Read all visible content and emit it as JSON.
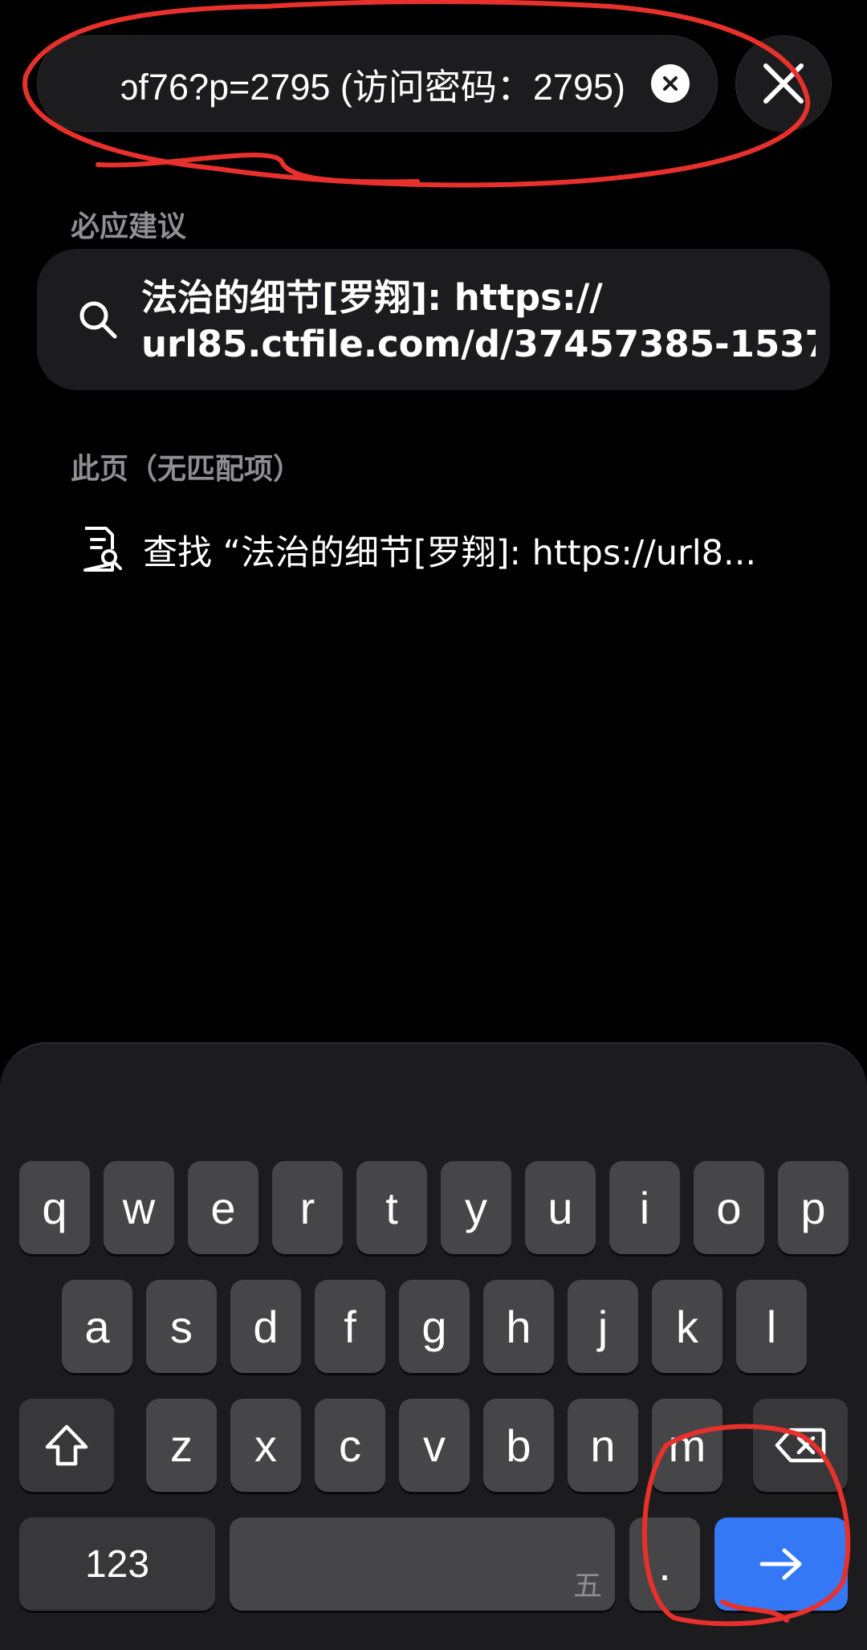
{
  "search": {
    "query_visible": "ɔf76?p=2795 (访问密码：2795)"
  },
  "suggestions": {
    "section_label": "必应建议",
    "item": {
      "bold_part": "法治的细节[罗翔]:",
      "rest_line1": " https://",
      "line2": "url85.ctfile.com/d/37457385-1537..."
    }
  },
  "this_page": {
    "section_label": "此页（无匹配项）",
    "find_text": "查找 “法治的细节[罗翔]: https://url8..."
  },
  "keyboard": {
    "row1": [
      "q",
      "w",
      "e",
      "r",
      "t",
      "y",
      "u",
      "i",
      "o",
      "p"
    ],
    "row2": [
      "a",
      "s",
      "d",
      "f",
      "g",
      "h",
      "j",
      "k",
      "l"
    ],
    "row3": [
      "z",
      "x",
      "c",
      "v",
      "b",
      "n",
      "m"
    ],
    "numbers_key": "123",
    "space_hint": "五",
    "period_key": ".",
    "icons": {
      "shift": "shift-icon",
      "delete": "delete-icon",
      "go": "arrow-right-icon"
    }
  },
  "colors": {
    "accent": "#3478f6",
    "annotation": "#e8302c",
    "background": "#000000",
    "card": "#1c1c1e",
    "key": "#464648"
  }
}
